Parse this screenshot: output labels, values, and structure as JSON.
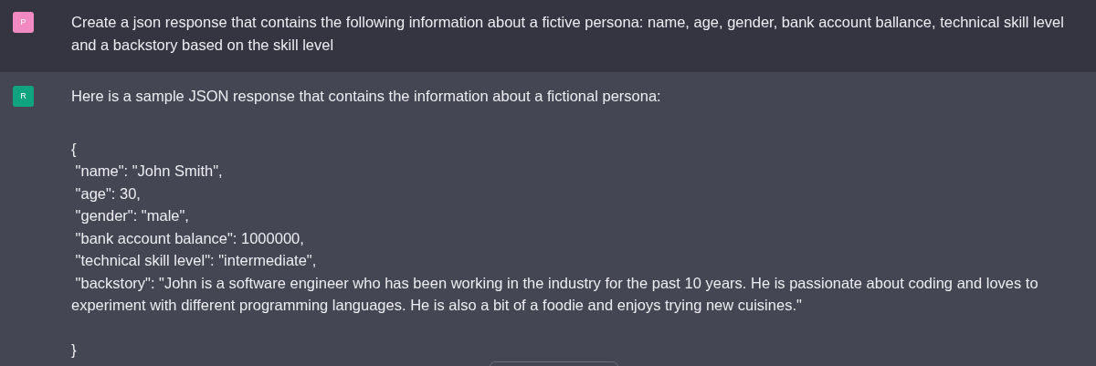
{
  "messages": [
    {
      "kind": "user",
      "avatar": "P",
      "color": "#f08ac0",
      "text": "Create a json response that contains the following information about a fictive persona: name, age, gender, bank account ballance, technical skill level and a backstory based on the skill level"
    },
    {
      "kind": "assistant",
      "avatar": "R",
      "color": "#10a37f",
      "text": "Here is a sample JSON response that contains the information about a fictional persona:",
      "code_lines": [
        "{",
        " \"name\": \"John Smith\",",
        " \"age\": 30,",
        " \"gender\": \"male\",",
        " \"bank account balance\": 1000000,",
        " \"technical skill level\": \"intermediate\",",
        " \"backstory\": \"John is a software engineer who has been working in the industry for the past 10 years. He is passionate about coding and loves to experiment with different programming languages. He is also a bit of a foodie and enjoys trying new cuisines.\"",
        "}"
      ]
    }
  ]
}
